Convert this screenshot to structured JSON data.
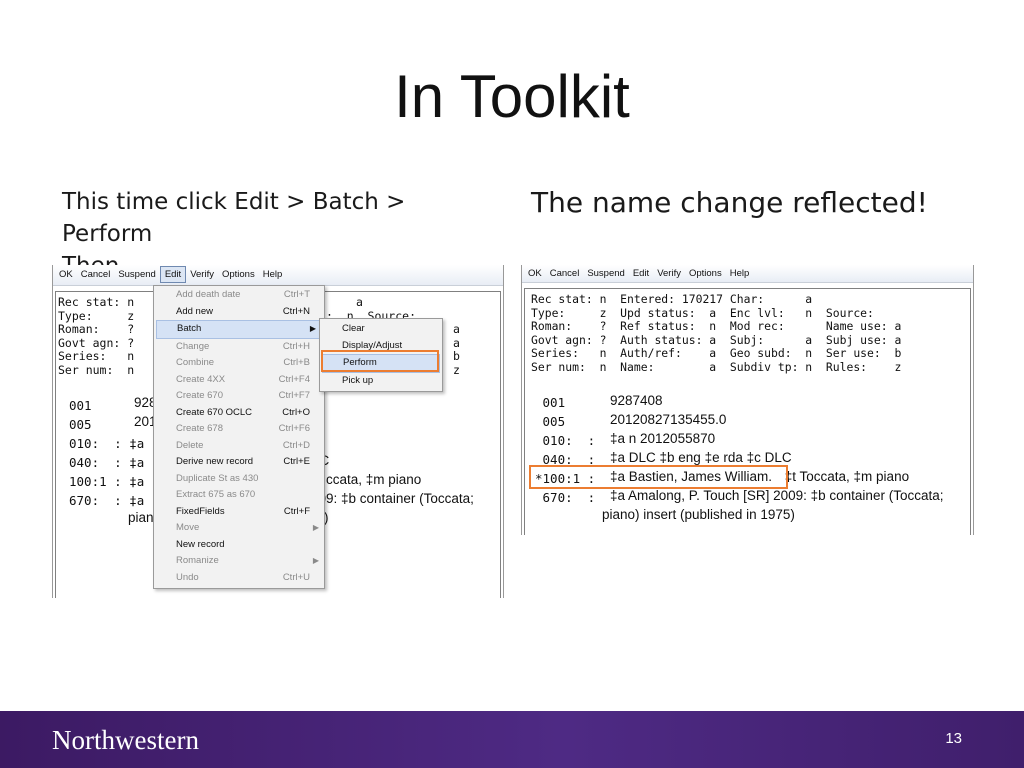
{
  "slide": {
    "title": "In Toolkit",
    "caption_left_line1": "This time click Edit > Batch > Perform",
    "caption_left_line2": "Then…",
    "caption_right": "The name change reflected!",
    "page_number": "13",
    "brand": "Northwestern",
    "highlight_color": "#ec7d31",
    "footer_color": "#4e2a84"
  },
  "left_screenshot": {
    "menubar": [
      "OK",
      "Cancel",
      "Suspend",
      "Edit",
      "Verify",
      "Options",
      "Help"
    ],
    "fixed_fields": [
      "Rec stat: n",
      "Type:     z",
      "Roman:    ?",
      "Govt agn: ?",
      "Series:   n",
      "Ser num:  n"
    ],
    "fixed_right": [
      "a",
      ":  n  Source:",
      "a",
      "a",
      "b",
      "z"
    ],
    "var_fields": [
      {
        "tag": "001",
        "value": "928"
      },
      {
        "tag": "005",
        "value": "201"
      },
      {
        "tag": "010:  : ‡a",
        "value": ""
      },
      {
        "tag": "040:  : ‡a",
        "value": "LC"
      },
      {
        "tag": "100:1 : ‡a",
        "value": "ccata, ‡m piano"
      },
      {
        "tag": "670:  : ‡a",
        "value": "009: ‡b container (Toccata;"
      }
    ],
    "continuation": "pian",
    "continuation_tail": ")",
    "edit_menu": [
      {
        "label": "Add death date",
        "shortcut": "Ctrl+T",
        "enabled": false
      },
      {
        "label": "Add new",
        "shortcut": "Ctrl+N",
        "enabled": true
      },
      {
        "label": "Batch",
        "shortcut": "",
        "enabled": true,
        "submenu": true
      },
      {
        "label": "Change",
        "shortcut": "Ctrl+H",
        "enabled": false
      },
      {
        "label": "Combine",
        "shortcut": "Ctrl+B",
        "enabled": false
      },
      {
        "label": "Create 4XX",
        "shortcut": "Ctrl+F4",
        "enabled": false
      },
      {
        "label": "Create 670",
        "shortcut": "Ctrl+F7",
        "enabled": false
      },
      {
        "label": "Create 670 OCLC",
        "shortcut": "Ctrl+O",
        "enabled": true
      },
      {
        "label": "Create 678",
        "shortcut": "Ctrl+F6",
        "enabled": false
      },
      {
        "label": "Delete",
        "shortcut": "Ctrl+D",
        "enabled": false
      },
      {
        "label": "Derive new record",
        "shortcut": "Ctrl+E",
        "enabled": true
      },
      {
        "label": "Duplicate St as 430",
        "shortcut": "",
        "enabled": false
      },
      {
        "label": "Extract 675 as 670",
        "shortcut": "",
        "enabled": false
      },
      {
        "label": "FixedFields",
        "shortcut": "Ctrl+F",
        "enabled": true
      },
      {
        "label": "Move",
        "shortcut": "",
        "enabled": false,
        "submenu": true
      },
      {
        "label": "New record",
        "shortcut": "",
        "enabled": true
      },
      {
        "label": "Romanize",
        "shortcut": "",
        "enabled": false,
        "submenu": true
      },
      {
        "label": "Undo",
        "shortcut": "Ctrl+U",
        "enabled": false
      }
    ],
    "batch_submenu": [
      "Clear",
      "Display/Adjust",
      "Perform",
      "Pick up"
    ]
  },
  "right_screenshot": {
    "menubar": [
      "OK",
      "Cancel",
      "Suspend",
      "Edit",
      "Verify",
      "Options",
      "Help"
    ],
    "fixed_fields": [
      "Rec stat: n  Entered: 170217 Char:      a",
      "Type:     z  Upd status:  a  Enc lvl:   n  Source:",
      "Roman:    ?  Ref status:  n  Mod rec:      Name use: a",
      "Govt agn: ?  Auth status: a  Subj:      a  Subj use: a",
      "Series:   n  Auth/ref:    a  Geo subd:  n  Ser use:  b",
      "Ser num:  n  Name:        a  Subdiv tp: n  Rules:    z"
    ],
    "var_fields": [
      {
        "tag": " 001",
        "value": "9287408"
      },
      {
        "tag": " 005",
        "value": "20120827135455.0"
      },
      {
        "tag": " 010:  : ",
        "value": "‡a n 2012055870"
      },
      {
        "tag": " 040:  : ",
        "value": "‡a DLC ‡b eng ‡e rda ‡c DLC"
      },
      {
        "tag": "*100:1 : ",
        "value": "‡a Bastien, James William.",
        "extra": " ‡t Toccata, ‡m piano"
      },
      {
        "tag": " 670:  : ",
        "value": "‡a Amalong, P. Touch [SR] 2009: ‡b container (Toccata;"
      }
    ],
    "continuation": "piano) insert (published in 1975)"
  }
}
